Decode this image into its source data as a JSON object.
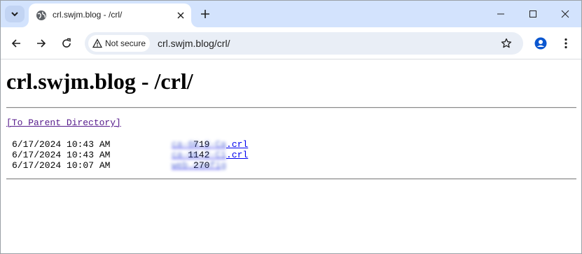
{
  "browser": {
    "tab_title": "crl.swjm.blog - /crl/",
    "security_chip": "Not secure",
    "url": "crl.swjm.blog/crl/"
  },
  "page": {
    "heading": "crl.swjm.blog - /crl/",
    "parent_link": "[To Parent Directory]",
    "files": [
      {
        "date": "6/17/2024 10:43 AM",
        "size": "719",
        "name_hidden": "ca-6K-2-Ca",
        "ext": ".crl"
      },
      {
        "date": "6/17/2024 10:43 AM",
        "size": "1142",
        "name_hidden": "ca-6K-2-C1",
        "ext": ".crl"
      },
      {
        "date": "6/17/2024 10:07 AM",
        "size": "270",
        "name_hidden": "web.config",
        "ext": ""
      }
    ]
  },
  "colors": {
    "tabstrip_bg": "#d3e3fd",
    "omnibox_bg": "#e9eef6",
    "link_blue": "#0000ee",
    "visited_purple": "#551a8b"
  },
  "icons": [
    "tab-search-icon",
    "globe-favicon-icon",
    "tab-close-icon",
    "new-tab-icon",
    "minimize-icon",
    "maximize-icon",
    "window-close-icon",
    "back-icon",
    "forward-icon",
    "reload-icon",
    "warning-triangle-icon",
    "bookmark-star-icon",
    "profile-icon",
    "menu-kebab-icon"
  ]
}
